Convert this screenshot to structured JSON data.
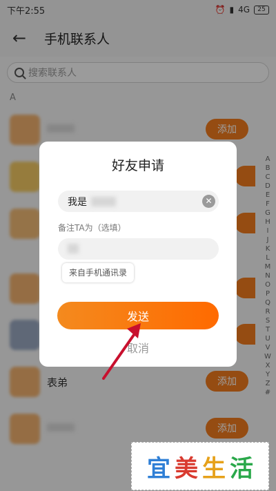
{
  "status_bar": {
    "time": "下午2:55",
    "network": "4G",
    "battery": "25"
  },
  "header": {
    "title": "手机联系人"
  },
  "search": {
    "placeholder": "搜索联系人"
  },
  "list": {
    "section_letter": "A",
    "add_label": "添加",
    "partial_name": "表弟"
  },
  "alphabet_index": [
    "A",
    "B",
    "C",
    "D",
    "E",
    "F",
    "G",
    "H",
    "I",
    "J",
    "K",
    "L",
    "M",
    "N",
    "O",
    "P",
    "Q",
    "R",
    "S",
    "T",
    "U",
    "V",
    "W",
    "X",
    "Y",
    "Z",
    "#"
  ],
  "dialog": {
    "title": "好友申请",
    "greeting_value": "我是",
    "remark_label": "备注TA为（选填）",
    "source_chip": "来自手机通讯录",
    "send_label": "发送",
    "cancel_label": "取消"
  },
  "watermark": {
    "chars": [
      "宜",
      "美",
      "生",
      "活"
    ],
    "colors": [
      "#2f7fd6",
      "#d93a2f",
      "#e6a11a",
      "#2aa84a"
    ]
  },
  "colors": {
    "accent": "#f07b1d",
    "arrow": "#c8102e"
  }
}
